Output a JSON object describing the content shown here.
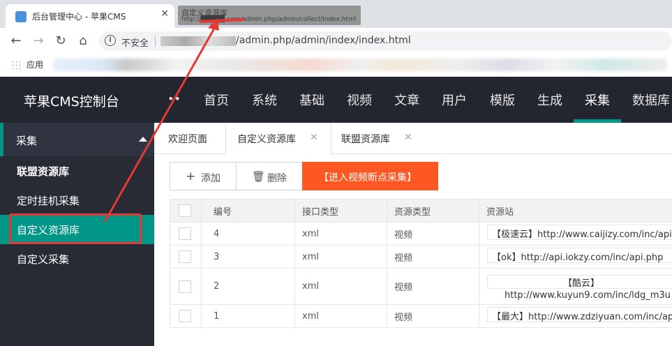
{
  "browser": {
    "active_tab_title": "后台管理中心 - 苹果CMS",
    "hover_tip_title": "自定义资源库",
    "hover_tip_url": "http://█████.com/admin.php/admin/collect/index.html",
    "insecure_label": "不安全",
    "url": "/admin.php/admin/index/index.html",
    "apps_label": "应用"
  },
  "header": {
    "logo": "苹果CMS控制台",
    "nav": [
      "首页",
      "系统",
      "基础",
      "视频",
      "文章",
      "用户",
      "模版",
      "生成",
      "采集",
      "数据库"
    ],
    "active_nav": "采集"
  },
  "sidebar": {
    "group": "采集",
    "items": [
      {
        "label": "联盟资源库",
        "active": false
      },
      {
        "label": "定时挂机采集",
        "active": false
      },
      {
        "label": "自定义资源库",
        "active": true
      },
      {
        "label": "自定义采集",
        "active": false
      }
    ]
  },
  "tabs": [
    {
      "label": "欢迎页面",
      "closable": false
    },
    {
      "label": "自定义资源库",
      "closable": true,
      "active": true
    },
    {
      "label": "联盟资源库",
      "closable": true
    }
  ],
  "toolbar": {
    "add_label": "添加",
    "delete_label": "删除",
    "collect_label": "【进入视频断点采集】"
  },
  "table": {
    "headers": [
      "编号",
      "接口类型",
      "资源类型",
      "资源站"
    ],
    "rows": [
      {
        "id": "4",
        "type": "xml",
        "res": "视频",
        "site": "【极速云】http://www.caijizy.com/inc/api"
      },
      {
        "id": "3",
        "type": "xml",
        "res": "视频",
        "site": "【ok】http://api.iokzy.com/inc/api.php"
      },
      {
        "id": "2",
        "type": "xml",
        "res": "视频",
        "site_line1": "【酷云】",
        "site_line2": "http://www.kuyun9.com/inc/ldg_m3u"
      },
      {
        "id": "1",
        "type": "xml",
        "res": "视频",
        "site": "【最大】http://www.zdziyuan.com/inc/ap"
      }
    ]
  },
  "colors": {
    "accent": "#009688",
    "header_bg": "#23262e",
    "sidebar_bg": "#393d49",
    "collect_btn": "#ff5722",
    "annotation": "#e53935"
  }
}
